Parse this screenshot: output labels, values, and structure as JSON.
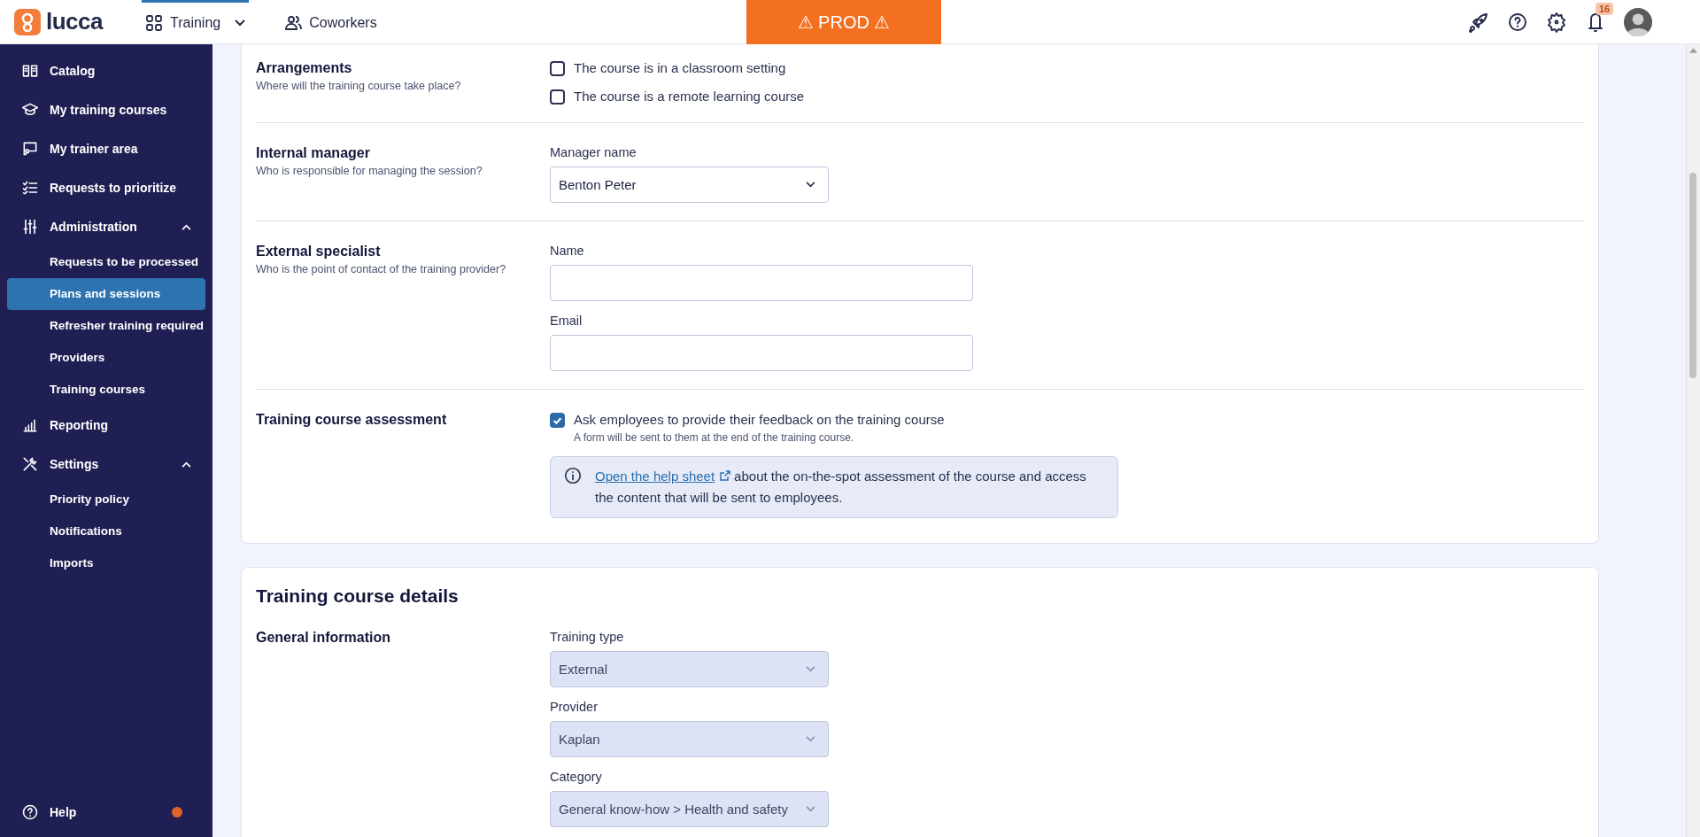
{
  "topbar": {
    "app_name": "lucca",
    "nav": [
      {
        "label": "Training",
        "selected": true,
        "kind": "dropdown"
      },
      {
        "label": "Coworkers",
        "selected": false,
        "kind": "link"
      }
    ],
    "environment_banner": "⚠ PROD ⚠",
    "notifications_count": "16"
  },
  "sidebar": {
    "items": [
      {
        "label": "Catalog",
        "selected": false
      },
      {
        "label": "My training courses",
        "selected": false
      },
      {
        "label": "My trainer area",
        "selected": false
      },
      {
        "label": "Requests to prioritize",
        "selected": false
      },
      {
        "label": "Administration",
        "selected": false,
        "expanded": true,
        "children": [
          {
            "label": "Requests to be processed",
            "selected": false
          },
          {
            "label": "Plans and sessions",
            "selected": true
          },
          {
            "label": "Refresher training required",
            "selected": false
          },
          {
            "label": "Providers",
            "selected": false
          },
          {
            "label": "Training courses",
            "selected": false
          }
        ]
      },
      {
        "label": "Reporting",
        "selected": false
      },
      {
        "label": "Settings",
        "selected": false,
        "expanded": true,
        "children": [
          {
            "label": "Priority policy",
            "selected": false
          },
          {
            "label": "Notifications",
            "selected": false
          },
          {
            "label": "Imports",
            "selected": false
          }
        ]
      }
    ],
    "help": {
      "label": "Help",
      "color": "#e0642a"
    }
  },
  "cards": [
    {
      "sections": [
        {
          "title": "Arrangements",
          "subtitle": "Where will the training course take place?",
          "kind": "checkboxes",
          "options": [
            {
              "label": "The course is in a classroom setting",
              "checked": false
            },
            {
              "label": "The course is a remote learning course",
              "checked": false
            }
          ]
        },
        {
          "title": "Internal manager",
          "subtitle": "Who is responsible for managing the session?",
          "kind": "fields",
          "fields": [
            {
              "label": "Manager name",
              "kind": "select",
              "value": "Benton Peter",
              "disabled": false
            }
          ]
        },
        {
          "title": "External specialist",
          "subtitle": "Who is the point of contact of the training provider?",
          "kind": "fields",
          "fields": [
            {
              "label": "Name",
              "kind": "text",
              "disabled": false
            },
            {
              "label": "Email",
              "kind": "text",
              "disabled": false
            }
          ]
        },
        {
          "title": "Training course assessment",
          "kind": "checkboxes",
          "options": [
            {
              "label": "Ask employees to provide their feedback on the training course",
              "hint": "A form will be sent to them at the end of the training course.",
              "checked": true
            }
          ],
          "info": {
            "link": "Open the help sheet",
            "text": "about the on-the-spot assessment of the course and access the content that will be sent to employees."
          }
        }
      ]
    },
    {
      "title": "Training course details",
      "sections": [
        {
          "title": "General information",
          "kind": "fields",
          "fields": [
            {
              "label": "Training type",
              "kind": "select",
              "value": "External",
              "disabled": true
            },
            {
              "label": "Provider",
              "kind": "select",
              "value": "Kaplan",
              "disabled": true
            },
            {
              "label": "Category",
              "kind": "select",
              "value": "General know-how > Health and safety",
              "disabled": true
            }
          ]
        }
      ]
    }
  ]
}
